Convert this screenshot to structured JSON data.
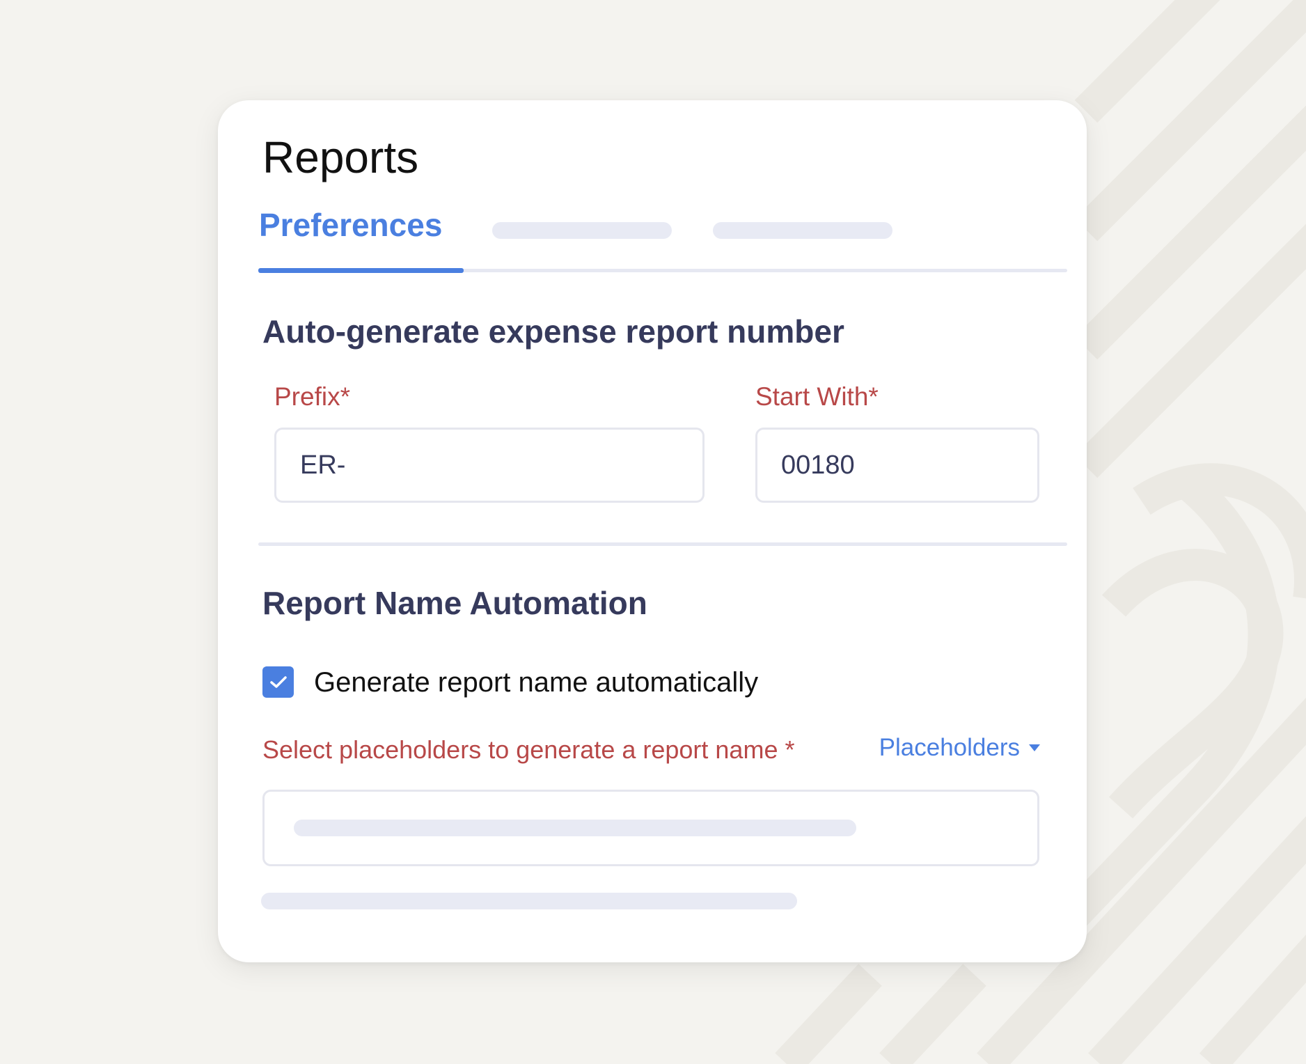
{
  "page": {
    "title": "Reports"
  },
  "tabs": {
    "active_label": "Preferences"
  },
  "auto_number": {
    "heading": "Auto-generate expense report number",
    "prefix_label": "Prefix*",
    "prefix_value": "ER-",
    "start_label": "Start With*",
    "start_value": "00180"
  },
  "name_automation": {
    "heading": "Report Name Automation",
    "checkbox_label": "Generate report name automatically",
    "checkbox_checked": true,
    "placeholder_prompt": "Select placeholders to generate a report name *",
    "placeholders_dropdown_label": "Placeholders"
  },
  "colors": {
    "accent": "#4a7fe0",
    "required_label": "#b84848",
    "heading": "#363a5c",
    "skeleton": "#e8eaf4"
  },
  "icons": {
    "checkbox": "check-icon",
    "dropdown": "caret-down-icon"
  }
}
